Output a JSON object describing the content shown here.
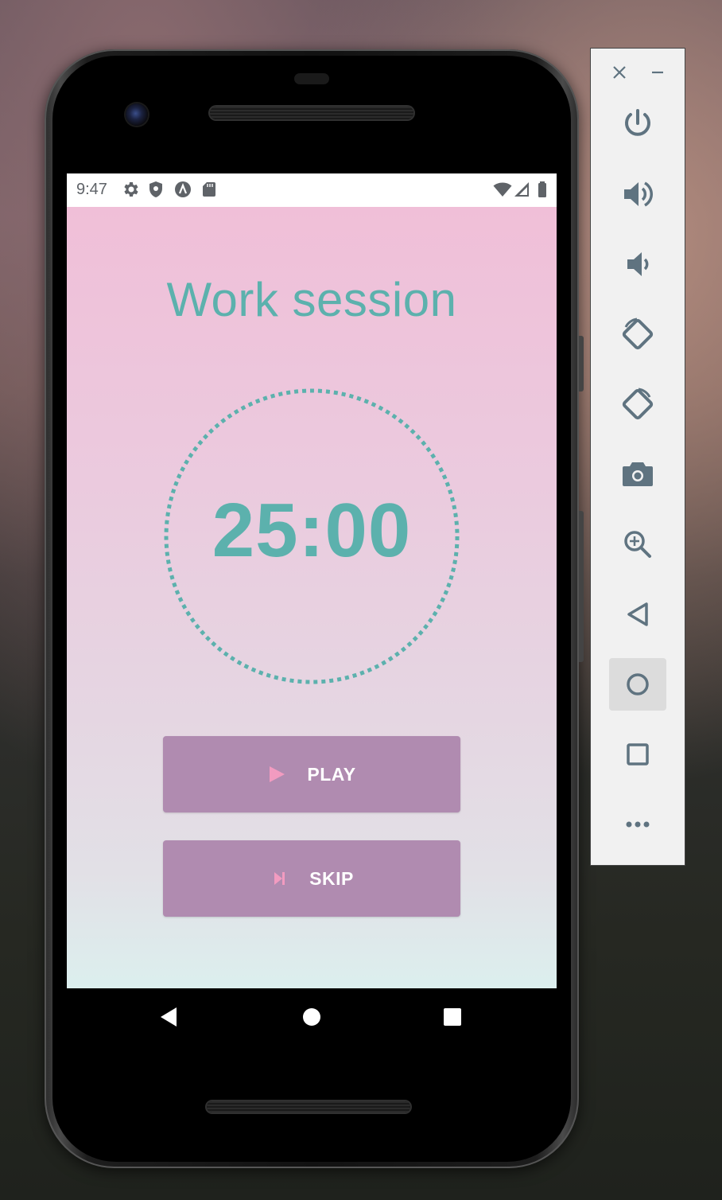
{
  "status_bar": {
    "time": "9:47",
    "icons": [
      "settings-icon",
      "shield-icon",
      "android-a-icon",
      "sd-card-icon",
      "wifi-icon",
      "cell-signal-icon",
      "battery-icon"
    ]
  },
  "app": {
    "title": "Work session",
    "timer": "25:00",
    "colors": {
      "accent": "#5cb1ad",
      "button": "#b08bb0",
      "button_icon": "#f29bc0"
    },
    "buttons": {
      "play_label": "PLAY",
      "skip_label": "SKIP"
    }
  },
  "navigation": [
    "back-icon",
    "home-icon",
    "recents-icon"
  ],
  "emulator_panel": {
    "window_controls": [
      "close-icon",
      "minimize-icon"
    ],
    "tools": [
      "power-icon",
      "volume-up-icon",
      "volume-down-icon",
      "rotate-left-icon",
      "rotate-right-icon",
      "camera-icon",
      "zoom-icon",
      "back-icon",
      "home-icon",
      "overview-icon",
      "more-icon"
    ]
  }
}
